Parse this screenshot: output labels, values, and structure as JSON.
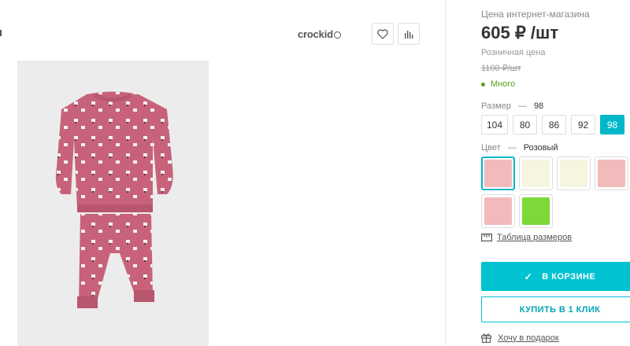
{
  "header": {
    "brand": "crockid",
    "icons": {
      "favorite": "heart-icon",
      "compare": "bar-chart-icon"
    }
  },
  "product": {
    "image": "pink-pajama-set-photo",
    "price_label": "Цена интернет-магазина",
    "price": "605 ₽ /шт",
    "retail_label": "Розничная цена",
    "retail_price": "1100 ₽/шт",
    "stock": "Много"
  },
  "size": {
    "label": "Размер",
    "dash": "—",
    "selected": "98",
    "options": [
      "104",
      "80",
      "86",
      "92",
      "98"
    ],
    "active_index": 4
  },
  "color": {
    "label": "Цвет",
    "dash": "—",
    "selected": "Розовый",
    "swatches": [
      "#f2babb",
      "#f5f5e0",
      "#f5f5e0",
      "#f2babb",
      "#f2babb",
      "#7ed83a"
    ],
    "active_index": 0
  },
  "links": {
    "size_table": "Таблица размеров",
    "gift": "Хочу в подарок"
  },
  "buttons": {
    "in_cart": "В КОРЗИНЕ",
    "buy_one_click": "КУПИТЬ В 1 КЛИК"
  },
  "colors": {
    "accent": "#00c2d1",
    "stock_green": "#56a318"
  }
}
